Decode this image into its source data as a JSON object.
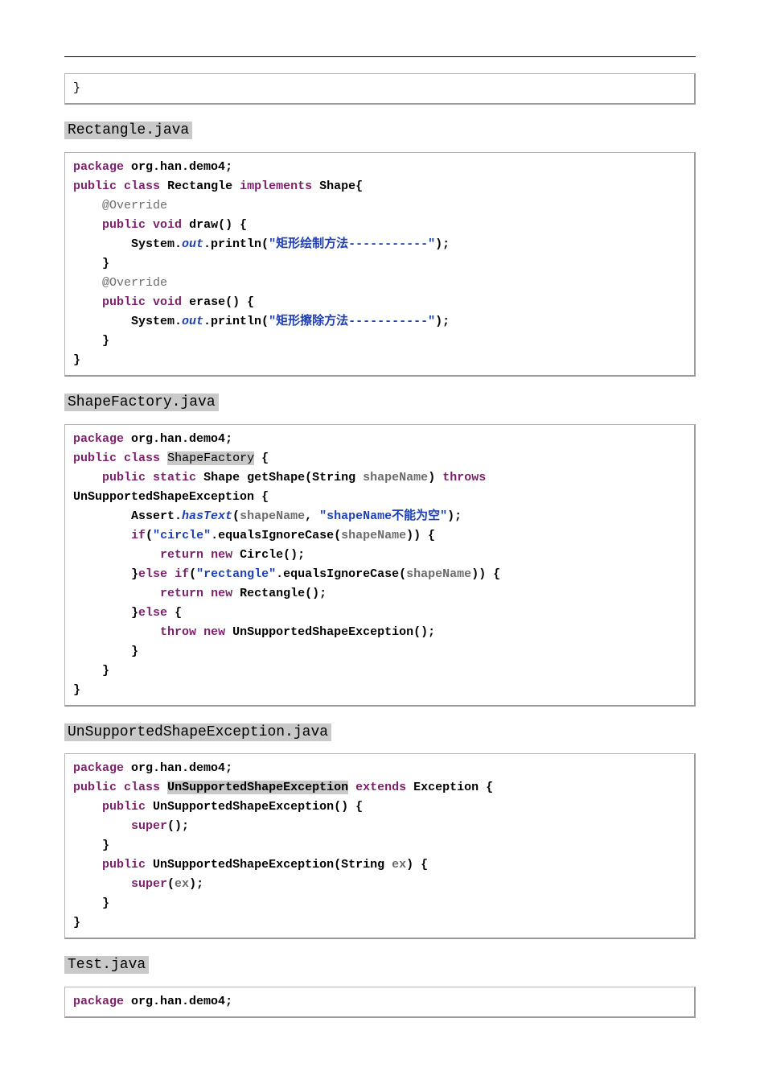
{
  "headings": {
    "rectangle": "Rectangle.java",
    "shapefactory": "ShapeFactory.java",
    "unsupported": "UnSupportedShapeException.java",
    "test": "Test.java"
  },
  "snippets": {
    "top_close": "}",
    "rectangle": {
      "pkg": "org.han.demo4",
      "classDef": "Rectangle",
      "implements": "Shape",
      "m1": "draw",
      "m1out": "矩形绘制方法-----------",
      "m2": "erase",
      "m2out": "矩形擦除方法-----------"
    },
    "shapefactory": {
      "pkg": "org.han.demo4",
      "classDef": "ShapeFactory",
      "method": "getShape",
      "retType": "Shape",
      "argType": "String",
      "argName": "shapeName",
      "throws": "UnSupportedShapeException",
      "assertMsg": "shapeName不能为空",
      "opt1": "circle",
      "cls1": "Circle",
      "opt2": "rectangle",
      "cls2": "Rectangle",
      "excCls": "UnSupportedShapeException"
    },
    "unsupported": {
      "pkg": "org.han.demo4",
      "classDef": "UnSupportedShapeException",
      "extends": "Exception",
      "ctor1": "UnSupportedShapeException",
      "ctor2": "UnSupportedShapeException",
      "ctor2argT": "String",
      "ctor2argN": "ex"
    },
    "test": {
      "pkg": "org.han.demo4"
    }
  }
}
